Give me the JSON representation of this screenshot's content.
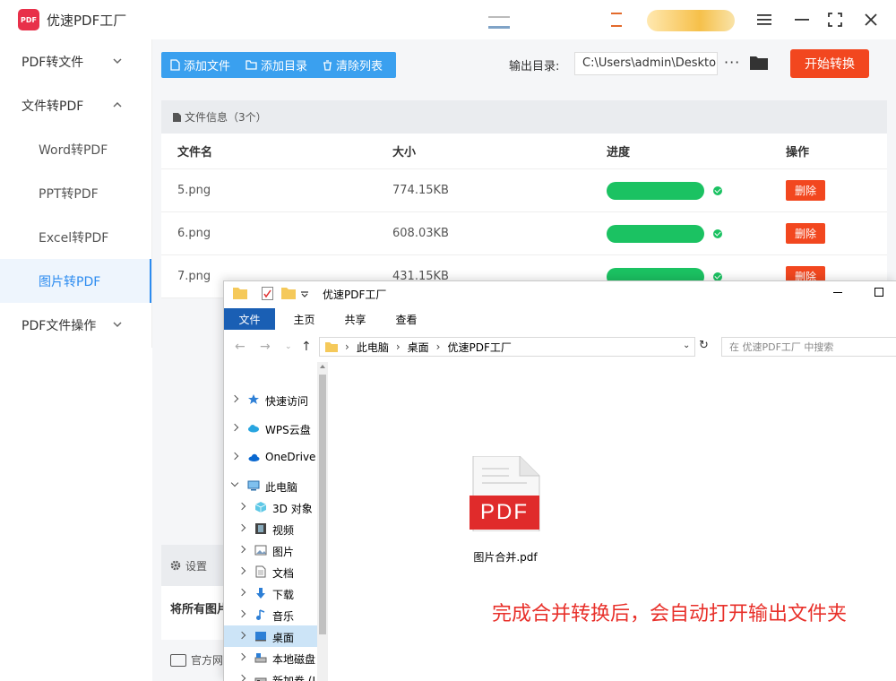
{
  "app": {
    "title": "优速PDF工厂",
    "logo_text": "PDF"
  },
  "sidebar": {
    "items": [
      {
        "label": "PDF转文件",
        "chevron": "down"
      },
      {
        "label": "文件转PDF",
        "chevron": "up"
      },
      {
        "label": "Word转PDF"
      },
      {
        "label": "PPT转PDF"
      },
      {
        "label": "Excel转PDF"
      },
      {
        "label": "图片转PDF",
        "active": true
      },
      {
        "label": "PDF文件操作",
        "chevron": "down"
      }
    ]
  },
  "toolbar": {
    "add_file": "添加文件",
    "add_dir": "添加目录",
    "clear_list": "清除列表",
    "output_label": "输出目录:",
    "output_path": "C:\\Users\\admin\\Desktop",
    "more": "···",
    "start": "开始转换"
  },
  "file_panel": {
    "header": "文件信息（3个）",
    "columns": [
      "文件名",
      "大小",
      "进度",
      "操作"
    ],
    "rows": [
      {
        "name": "5.png",
        "size": "774.15KB",
        "progress": 1.0,
        "action": "删除"
      },
      {
        "name": "6.png",
        "size": "608.03KB",
        "progress": 1.0,
        "action": "删除"
      },
      {
        "name": "7.png",
        "size": "431.15KB",
        "progress": 1.0,
        "action": "删除"
      }
    ]
  },
  "settings": {
    "label": "设置",
    "text": "将所有图片",
    "footer": "官方网"
  },
  "explorer": {
    "title": "优速PDF工厂",
    "tabs": [
      "文件",
      "主页",
      "共享",
      "查看"
    ],
    "breadcrumb": [
      "此电脑",
      "桌面",
      "优速PDF工厂"
    ],
    "search_placeholder": "在 优速PDF工厂 中搜索",
    "tree": [
      {
        "label": "快速访问",
        "icon": "star-icon"
      },
      {
        "label": "WPS云盘",
        "icon": "cloud-icon"
      },
      {
        "label": "OneDrive",
        "icon": "onedrive-icon"
      },
      {
        "label": "此电脑",
        "icon": "computer-icon"
      },
      {
        "label": "3D 对象",
        "icon": "cube-icon"
      },
      {
        "label": "视频",
        "icon": "video-icon"
      },
      {
        "label": "图片",
        "icon": "picture-icon"
      },
      {
        "label": "文档",
        "icon": "document-icon"
      },
      {
        "label": "下载",
        "icon": "download-icon"
      },
      {
        "label": "音乐",
        "icon": "music-icon"
      },
      {
        "label": "桌面",
        "icon": "desktop-icon",
        "selected": true
      },
      {
        "label": "本地磁盘",
        "icon": "disk-icon"
      },
      {
        "label": "新加卷 (I",
        "icon": "drive-icon"
      }
    ],
    "file": {
      "name": "图片合并.pdf",
      "badge": "PDF"
    },
    "annotation": "完成合并转换后，会自动打开输出文件夹"
  },
  "colors": {
    "accent": "#2d8cf0",
    "primary_button": "#f2471f",
    "toolbar_blue": "#3aa0ef",
    "progress": "#1bc262",
    "annotation": "#e8302a"
  }
}
